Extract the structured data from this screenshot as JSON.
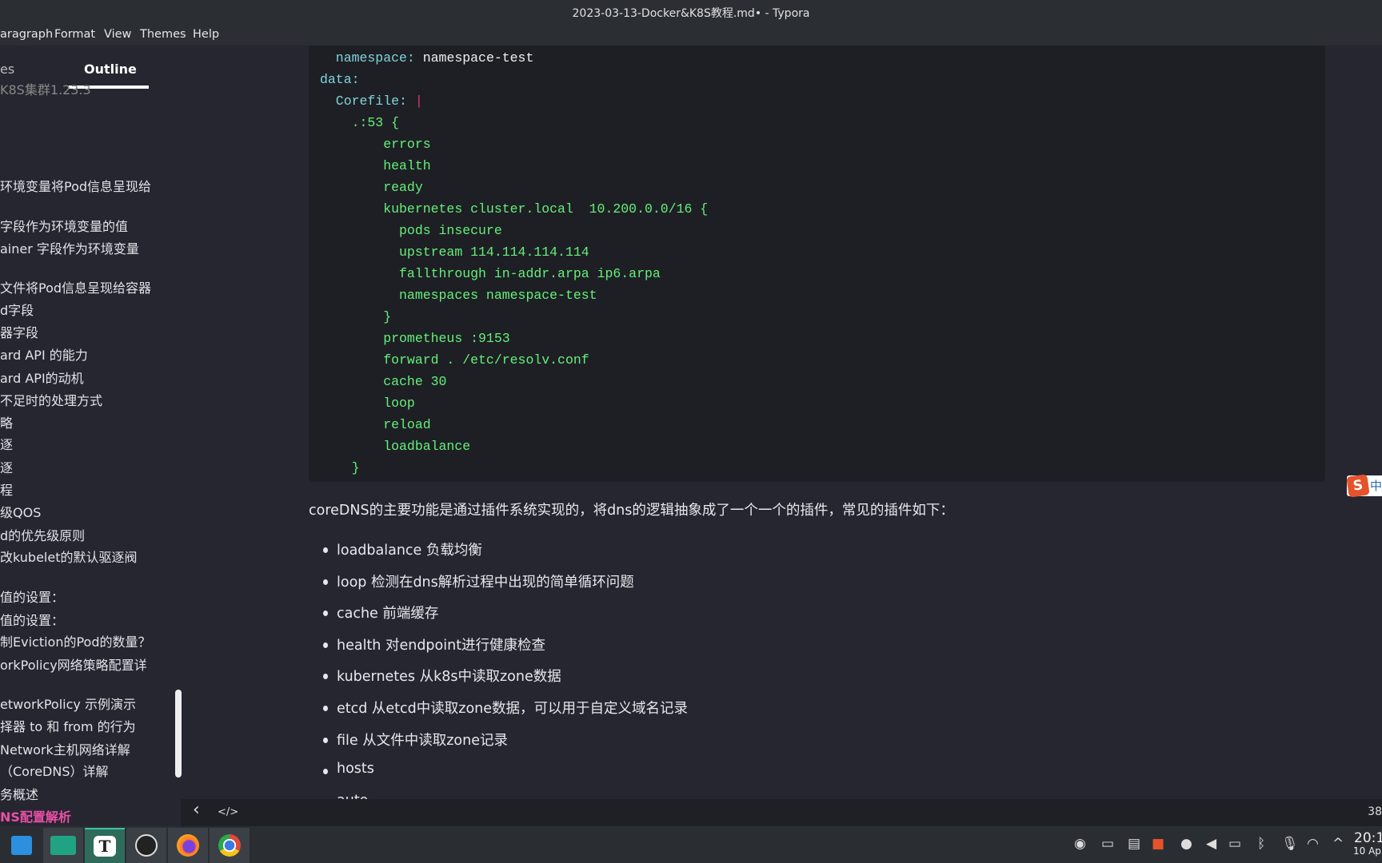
{
  "window": {
    "title": "2023-03-13-Docker&K8S教程.md• - Typora"
  },
  "menu": [
    "aragraph",
    "Format",
    "View",
    "Themes",
    "Help"
  ],
  "sidebar": {
    "tabs": {
      "files": "es",
      "outline": "Outline"
    },
    "items": [
      "K8S集群1.23.3",
      "环境变量将Pod信息呈现给",
      "字段作为环境变量的值",
      "ainer 字段作为环境变量",
      "文件将Pod信息呈现给容器",
      "d字段",
      "器字段",
      "ard API 的能力",
      "ard API的动机",
      "不足时的处理方式",
      "略",
      "逐",
      "逐",
      "程",
      "级QOS",
      "d的优先级原则",
      "改kubelet的默认驱逐阀",
      "值的设置：",
      "值的设置：",
      "制Eviction的Pod的数量？",
      "orkPolicy网络策略配置详",
      "etworkPolicy 示例演示",
      "择器 to 和 from 的行为",
      "Network主机网络详解",
      "（CoreDNS）详解",
      "务概述",
      "NS配置解析"
    ],
    "active_index": 26
  },
  "code": {
    "lines": [
      [
        [
          "key",
          "  namespace"
        ],
        [
          "key",
          ": "
        ],
        [
          "val",
          "namespace-test"
        ]
      ],
      [
        [
          "key",
          "data"
        ],
        [
          "key",
          ":"
        ]
      ],
      [
        [
          "key",
          "  Corefile"
        ],
        [
          "key",
          ": "
        ],
        [
          "pipe",
          "|"
        ]
      ],
      [
        [
          "str",
          "    .:53 {"
        ]
      ],
      [
        [
          "str",
          "        errors"
        ]
      ],
      [
        [
          "str",
          "        health"
        ]
      ],
      [
        [
          "str",
          "        ready"
        ]
      ],
      [
        [
          "str",
          "        kubernetes cluster.local  10.200.0.0/16 {"
        ]
      ],
      [
        [
          "str",
          "          pods insecure"
        ]
      ],
      [
        [
          "str",
          "          upstream 114.114.114.114"
        ]
      ],
      [
        [
          "str",
          "          fallthrough in-addr.arpa ip6.arpa"
        ]
      ],
      [
        [
          "str",
          "          namespaces namespace-test"
        ]
      ],
      [
        [
          "str",
          "        }"
        ]
      ],
      [
        [
          "str",
          "        prometheus :9153"
        ]
      ],
      [
        [
          "str",
          "        forward . /etc/resolv.conf"
        ]
      ],
      [
        [
          "str",
          "        cache 30"
        ]
      ],
      [
        [
          "str",
          "        loop"
        ]
      ],
      [
        [
          "str",
          "        reload"
        ]
      ],
      [
        [
          "str",
          "        loadbalance"
        ]
      ],
      [
        [
          "str",
          "    }"
        ]
      ]
    ]
  },
  "content": {
    "paragraph": "coreDNS的主要功能是通过插件系统实现的，将dns的逻辑抽象成了一个一个的插件，常见的插件如下：",
    "list": [
      "loadbalance 负载均衡",
      "loop 检测在dns解析过程中出现的简单循环问题",
      "cache 前端缓存",
      "health  对endpoint进行健康检查",
      "kubernetes  从k8s中读取zone数据",
      "etcd  从etcd中读取zone数据，可以用于自定义域名记录",
      "file 从文件中读取zone记录",
      "hosts",
      "auto"
    ]
  },
  "statusbar": {
    "back": "‹",
    "source": "</>",
    "word_count": "38"
  },
  "ime": {
    "logo": "S",
    "label": "中"
  },
  "taskbar": {
    "apps": [
      "app-store-icon",
      "file-manager-icon",
      "typora-icon",
      "obs-icon",
      "firefox-icon",
      "chrome-icon"
    ],
    "typora_letter": "T",
    "clock": "20:1",
    "date": "10 Ap"
  },
  "colors": {
    "background": "#262631",
    "code_bg": "#1e1f24",
    "code_green": "#64f07a",
    "code_key": "#7fd3dc",
    "outline_active": "#e84fa4"
  }
}
